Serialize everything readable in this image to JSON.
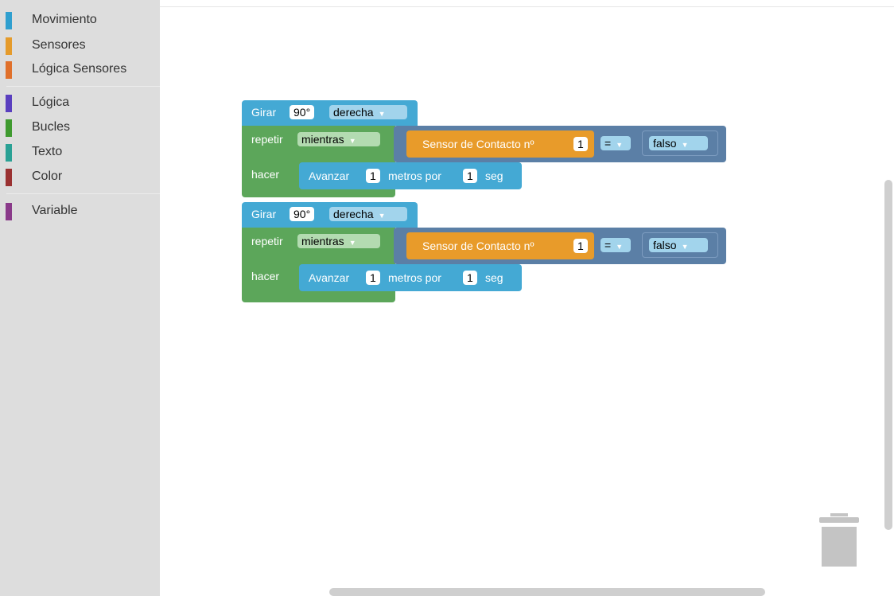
{
  "toolbox": {
    "categories": [
      {
        "label": "Movimiento",
        "color": "#2f9fcf"
      },
      {
        "label": "Sensores",
        "color": "#e59b2b"
      },
      {
        "label": "Lógica Sensores",
        "color": "#e0702b"
      },
      {
        "label": "Lógica",
        "color": "#5a3fbf"
      },
      {
        "label": "Bucles",
        "color": "#3f9a2f"
      },
      {
        "label": "Texto",
        "color": "#2aa195"
      },
      {
        "label": "Color",
        "color": "#9a3131"
      },
      {
        "label": "Variable",
        "color": "#8a3a8a"
      }
    ]
  },
  "workspace": {
    "groups": [
      {
        "turn": {
          "label": "Girar",
          "angle": "90°",
          "direction": "derecha"
        },
        "loop": {
          "repeat_label": "repetir",
          "mode": "mientras",
          "do_label": "hacer"
        },
        "condition": {
          "sensor_label": "Sensor de Contacto nº",
          "sensor_num": "1",
          "operator": "=",
          "value": "falso"
        },
        "move": {
          "label": "Avanzar",
          "distance": "1",
          "unit_label": "metros por",
          "time": "1",
          "time_unit": "seg"
        }
      },
      {
        "turn": {
          "label": "Girar",
          "angle": "90°",
          "direction": "derecha"
        },
        "loop": {
          "repeat_label": "repetir",
          "mode": "mientras",
          "do_label": "hacer"
        },
        "condition": {
          "sensor_label": "Sensor de Contacto nº",
          "sensor_num": "1",
          "operator": "=",
          "value": "falso"
        },
        "move": {
          "label": "Avanzar",
          "distance": "1",
          "unit_label": "metros por",
          "time": "1",
          "time_unit": "seg"
        }
      }
    ]
  },
  "trash": {
    "icon": "trash-icon"
  }
}
